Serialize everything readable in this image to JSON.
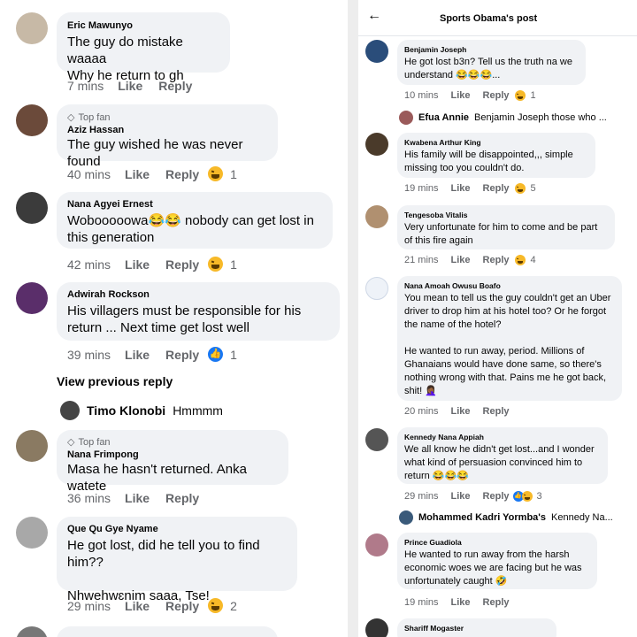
{
  "left": {
    "comments": [
      {
        "name": "Eric Mawunyo",
        "text": "The guy do mistake waaaa\nWhy he return to gh",
        "time": "7 mins",
        "like": "Like",
        "reply": "Reply"
      },
      {
        "badge": "Top fan",
        "name": "Aziz Hassan",
        "text": "The guy wished he was never found",
        "time": "40 mins",
        "like": "Like",
        "reply": "Reply",
        "reaction_count": "1"
      },
      {
        "name": "Nana Agyei Ernest",
        "text": "Wobooooowa😂😂 nobody can get lost in this generation",
        "time": "42 mins",
        "like": "Like",
        "reply": "Reply",
        "reaction_count": "1"
      },
      {
        "name": "Adwirah Rockson",
        "text": "His villagers must be responsible for his return ... Next time get lost well",
        "time": "39 mins",
        "like": "Like",
        "reply": "Reply",
        "reaction_count": "1"
      },
      {
        "badge": "Top fan",
        "name": "Nana Frimpong",
        "text": "Masa he hasn't returned. Anka watete",
        "time": "36 mins",
        "like": "Like",
        "reply": "Reply"
      },
      {
        "name": "Que Qu Gye Nyame",
        "text": "He got lost, did he tell you to find him??\n\nNhwehwɛnim saaa, Tse!",
        "time": "29 mins",
        "like": "Like",
        "reply": "Reply",
        "reaction_count": "2"
      }
    ],
    "view_previous": "View previous reply",
    "timo": {
      "name": "Timo Klonobi",
      "text": "Hmmmm"
    }
  },
  "right": {
    "header_title": "Sports Obama's post",
    "comments": [
      {
        "name": "Benjamin Joseph",
        "text": "He got lost b3n? Tell us the truth na we understand 😂😂😂...",
        "time": "10 mins",
        "like": "Like",
        "reply": "Reply",
        "reaction_count": "1"
      },
      {
        "name": "Kwabena Arthur King",
        "text": "His family will be disappointed,,, simple missing too you couldn't do.",
        "time": "19 mins",
        "like": "Like",
        "reply": "Reply",
        "reaction_count": "5"
      },
      {
        "name": "Tengesoba Vitalis",
        "text": "Very unfortunate for him to come and be part of this fire again",
        "time": "21 mins",
        "like": "Like",
        "reply": "Reply",
        "reaction_count": "4"
      },
      {
        "name": "Nana Amoah Owusu Boafo",
        "text": "You mean to tell us the guy couldn't get an Uber driver to drop him at his hotel too? Or he forgot the name of the hotel?\n\nHe wanted to run away, period. Millions of Ghanaians would have done same, so there's nothing wrong with that. Pains me he got back, shit! 🤦🏾‍♀️",
        "time": "20 mins",
        "like": "Like",
        "reply": "Reply"
      },
      {
        "name": "Kennedy Nana Appiah",
        "text": "We all know he didn't get lost...and I wonder what kind of persuasion convinced him to return 😂😂😂",
        "time": "29 mins",
        "like": "Like",
        "reply": "Reply",
        "reaction_count": "3"
      },
      {
        "name": "Prince Guadiola",
        "text": "He wanted to run away from the harsh economic woes we are facing but he was unfortunately caught 🤣",
        "time": "19 mins",
        "like": "Like",
        "reply": "Reply"
      },
      {
        "name": "Shariff Mogaster"
      }
    ],
    "reply_previews": [
      {
        "name": "Efua Annie",
        "text": "Benjamin Joseph those who ..."
      },
      {
        "name": "Mohammed Kadri Yormba's",
        "text": "Kennedy Na..."
      }
    ]
  }
}
